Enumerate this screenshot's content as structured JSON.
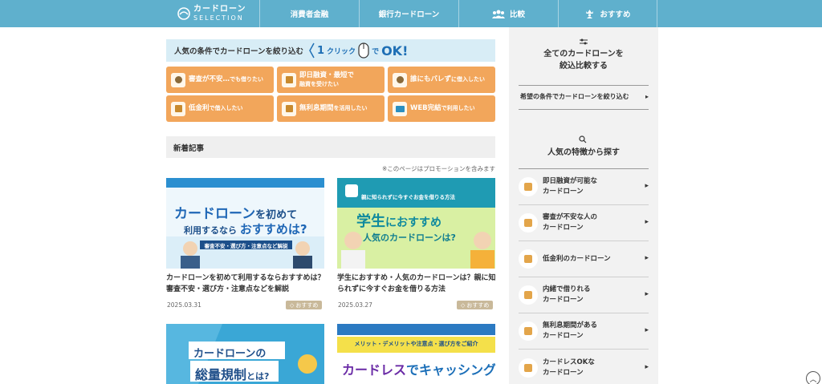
{
  "header": {
    "logo_main": "カードローン",
    "logo_sub": "SELECTION",
    "nav": [
      {
        "label": "消費者金融"
      },
      {
        "label": "銀行カードローン"
      },
      {
        "label": "比較"
      },
      {
        "label": "おすすめ"
      }
    ]
  },
  "filter": {
    "title": "人気の条件でカードローンを絞り込む",
    "oneclick_num": "1",
    "oneclick_word": "クリック",
    "oneclick_de": "で",
    "oneclick_ok": "OK!",
    "tiles": [
      {
        "label_main": "審査が不安…",
        "label_sub": "でも借りたい",
        "icon": "magnifier-icon"
      },
      {
        "label_main": "即日融資・最短で",
        "label_sub": "融資を受けたい",
        "icon": "calendar-icon"
      },
      {
        "label_main": "誰にもバレず",
        "label_sub": "に借入したい",
        "icon": "secret-icon"
      },
      {
        "label_main": "低金利",
        "label_sub": "で借入したい",
        "icon": "coins-icon"
      },
      {
        "label_main": "無利息期間",
        "label_sub": "を活用したい",
        "icon": "coins-icon"
      },
      {
        "label_main": "WEB完結",
        "label_sub": "で利用したい",
        "icon": "laptop-icon"
      }
    ]
  },
  "news": {
    "heading": "新着記事",
    "promo": "※このページはプロモーションを含みます",
    "articles": [
      {
        "banner_l1": "カードローン",
        "banner_l1b": "を初めて",
        "banner_l2": "利用するなら",
        "banner_l2b": "おすすめは?",
        "banner_strip": "審査不安・選び方・注意点など解説",
        "title": "カードローンを初めて利用するならおすすめは？審査不安・選び方・注意点などを解説",
        "date": "2025.03.31",
        "tag": "おすすめ"
      },
      {
        "banner_top": "親に知られずに今すぐお金を借りる方法",
        "banner_l1": "学生",
        "banner_l1b": "におすすめ",
        "banner_l2": "人気のカードローンは?",
        "title": "学生におすすめ・人気のカードローンは？親に知られずに今すぐお金を借りる方法",
        "date": "2025.03.27",
        "tag": "おすすめ"
      },
      {
        "banner_l1": "カードローンの",
        "banner_l2": "総量規制",
        "banner_l2b": "とは?"
      },
      {
        "banner_top": "メリット・デメリットや注意点・選び方をご紹介",
        "banner_l1": "カードレス",
        "banner_l1b": "でキャッシング"
      }
    ]
  },
  "sidebar": {
    "compare_title_1": "全てのカードローンを",
    "compare_title_2": "絞込比較する",
    "compare_link": "希望の条件でカードローンを絞り込む",
    "feature_title": "人気の特徴から探す",
    "features": [
      {
        "l1": "即日融資が可能な",
        "l2": "カードローン"
      },
      {
        "l1": "審査が不安な人の",
        "l2": "カードローン"
      },
      {
        "l1": "低金利のカードローン",
        "l2": ""
      },
      {
        "l1": "内緒で借りれる",
        "l2": "カードローン"
      },
      {
        "l1": "無利息期間がある",
        "l2": "カードローン"
      },
      {
        "l1": "カードレスOKな",
        "l2": "カードローン"
      }
    ]
  },
  "colors": {
    "header_bg": "#5fb0cd",
    "tile_bg": "#f2a65b",
    "sidebar_bg": "#f2f2f2",
    "accent_blue": "#1e6fb5"
  }
}
